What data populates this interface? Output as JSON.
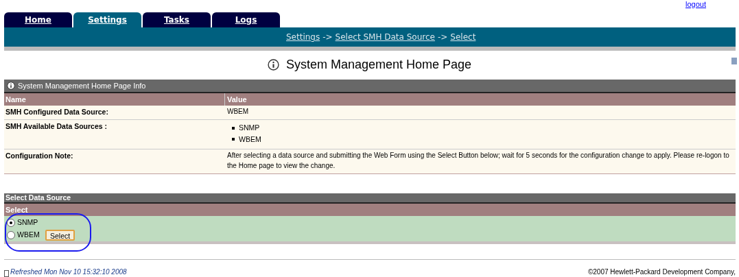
{
  "logout_link": "logout",
  "tabs": [
    {
      "label": "Home",
      "selected": false
    },
    {
      "label": "Settings",
      "selected": true
    },
    {
      "label": "Tasks",
      "selected": false
    },
    {
      "label": "Logs",
      "selected": false
    }
  ],
  "breadcrumb": [
    "Settings",
    "Select SMH Data Source",
    "Select"
  ],
  "breadcrumb_separator": "->",
  "page_title": "System Management Home Page",
  "info_panel": {
    "title": "System Management Home Page Info",
    "columns": [
      "Name",
      "Value"
    ],
    "rows": [
      {
        "kind": "text",
        "name": "SMH Configured Data Source:",
        "value": "WBEM"
      },
      {
        "kind": "list",
        "name": "SMH Available Data Sources :",
        "items": [
          "SNMP",
          "WBEM"
        ]
      },
      {
        "kind": "text",
        "name": "Configuration Note:",
        "value": "After selecting a data source and submitting the Web Form using the Select Button below; wait for 5 seconds for the configuration change to apply. Please re-logon to the Home page to view the change."
      }
    ]
  },
  "select_panel": {
    "title": "Select Data Source",
    "column": "Select",
    "options": [
      {
        "label": "SNMP",
        "selected": true
      },
      {
        "label": "WBEM",
        "selected": false
      }
    ],
    "button": "Select"
  },
  "footer": {
    "refreshed": "Refreshed Mon Nov 10 15:32:10 2008",
    "copyright": "©2007 Hewlett-Packard Development Company,"
  }
}
